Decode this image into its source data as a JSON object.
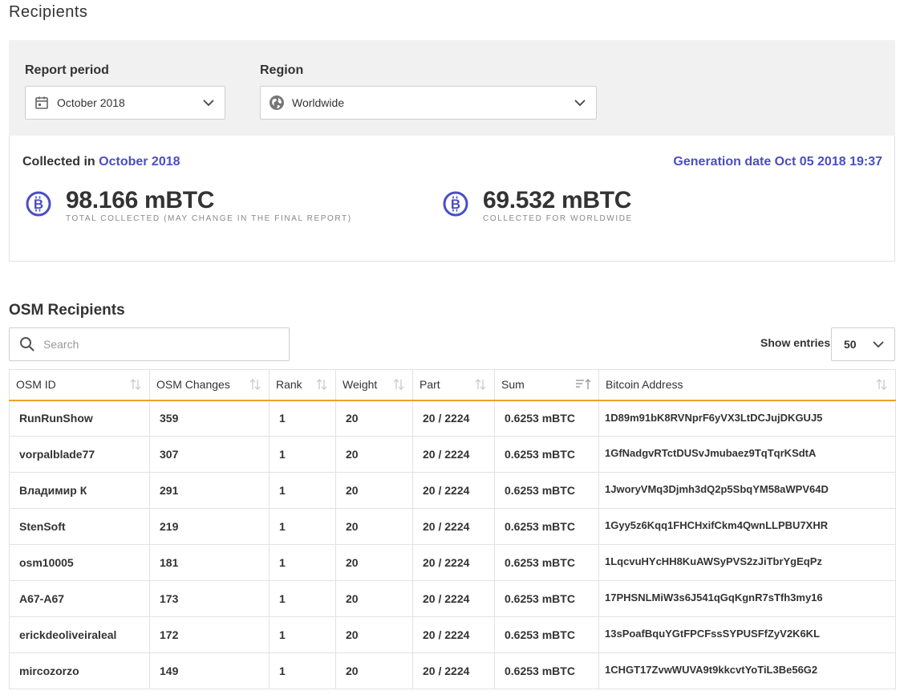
{
  "page": {
    "title": "Recipients"
  },
  "filters": {
    "report_period_label": "Report period",
    "report_period_value": "October 2018",
    "region_label": "Region",
    "region_value": "Worldwide"
  },
  "summary": {
    "collected_prefix": "Collected in",
    "collected_month": "October 2018",
    "generation_date": "Generation date Oct 05 2018 19:37",
    "total_amount": "98.166 mBTC",
    "total_caption": "TOTAL COLLECTED (MAY CHANGE IN THE FINAL REPORT)",
    "region_amount": "69.532 mBTC",
    "region_caption": "COLLECTED FOR WORLDWIDE"
  },
  "section": {
    "title": "OSM Recipients"
  },
  "search": {
    "placeholder": "Search",
    "value": ""
  },
  "entries": {
    "label": "Show entries",
    "value": "50"
  },
  "table": {
    "columns": [
      "OSM ID",
      "OSM Changes",
      "Rank",
      "Weight",
      "Part",
      "Sum",
      "Bitcoin Address"
    ],
    "rows": [
      [
        "RunRunShow",
        "359",
        "1",
        "20",
        "20 / 2224",
        "0.6253 mBTC",
        "1D89m91bK8RVNprF6yVX3LtDCJujDKGUJ5"
      ],
      [
        "vorpalblade77",
        "307",
        "1",
        "20",
        "20 / 2224",
        "0.6253 mBTC",
        "1GfNadgvRTctDUSvJmubaez9TqTqrKSdtA"
      ],
      [
        "Владимир К",
        "291",
        "1",
        "20",
        "20 / 2224",
        "0.6253 mBTC",
        "1JworyVMq3Djmh3dQ2p5SbqYM58aWPV64D"
      ],
      [
        "StenSoft",
        "219",
        "1",
        "20",
        "20 / 2224",
        "0.6253 mBTC",
        "1Gyy5z6Kqq1FHCHxifCkm4QwnLLPBU7XHR"
      ],
      [
        "osm10005",
        "181",
        "1",
        "20",
        "20 / 2224",
        "0.6253 mBTC",
        "1LqcvuHYcHH8KuAWSyPVS2zJiTbrYgEqPz"
      ],
      [
        "A67-A67",
        "173",
        "1",
        "20",
        "20 / 2224",
        "0.6253 mBTC",
        "17PHSNLMiW3s6J541qGqKgnR7sTfh3my16"
      ],
      [
        "erickdeoliveiraleal",
        "172",
        "1",
        "20",
        "20 / 2224",
        "0.6253 mBTC",
        "13sPoafBquYGtFPCFssSYPUSFfZyV2K6KL"
      ],
      [
        "mircozorzo",
        "149",
        "1",
        "20",
        "20 / 2224",
        "0.6253 mBTC",
        "1CHGT17ZvwWUVA9t9kkcvtYoTiL3Be56G2"
      ]
    ]
  },
  "colors": {
    "accent": "#4a4ec4",
    "header_underline": "#f0a030",
    "panel_bg": "#f1f1f1"
  },
  "icons": {
    "period": "calendar-icon",
    "region": "globe-icon",
    "dropdown": "chevron-down-icon",
    "currency": "bitcoin-icon",
    "search": "search-icon",
    "sort": "sort-icon"
  }
}
